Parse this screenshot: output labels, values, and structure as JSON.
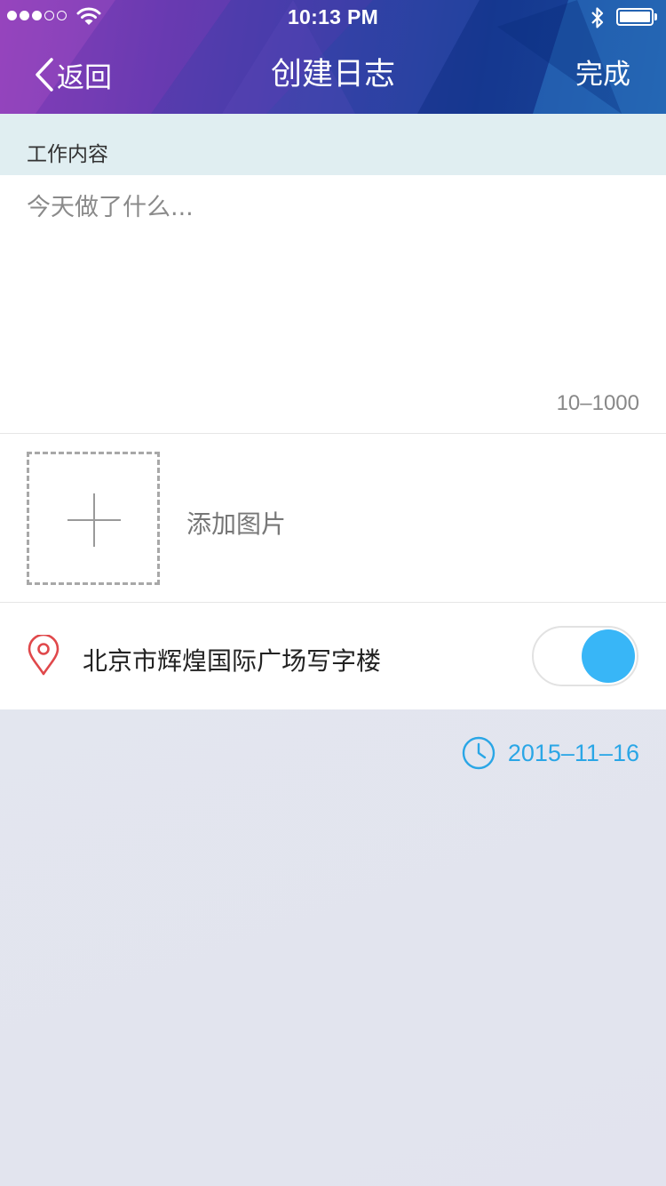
{
  "status_bar": {
    "time": "10:13 PM",
    "signal_full": 3,
    "signal_total": 5
  },
  "nav": {
    "back_label": "返回",
    "title": "创建日志",
    "done_label": "完成"
  },
  "work": {
    "section_label": "工作内容",
    "placeholder": "今天做了什么...",
    "value": "",
    "char_limit": "10–1000"
  },
  "photos": {
    "add_label": "添加图片"
  },
  "location": {
    "text": "北京市辉煌国际广场写字楼",
    "enabled": true
  },
  "date": {
    "value": "2015–11–16"
  },
  "colors": {
    "accent": "#38b6f7",
    "date_text": "#2aa6e6",
    "pin": "#e0484b"
  }
}
